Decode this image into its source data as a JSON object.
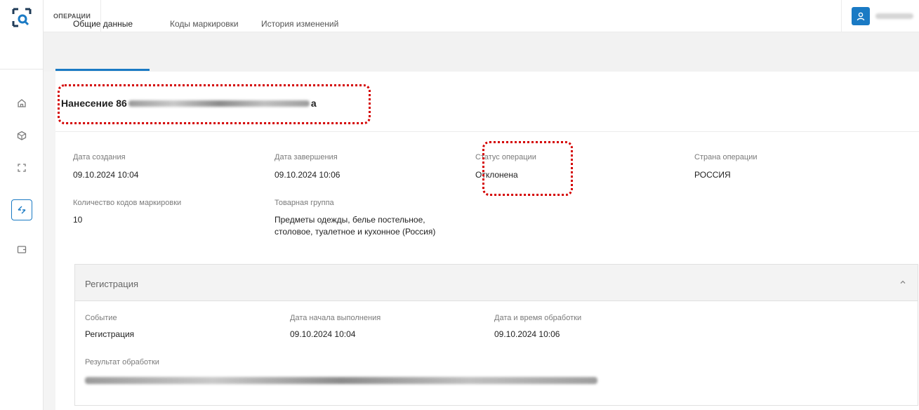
{
  "app": {
    "section_title": "ОПЕРАЦИИ"
  },
  "sidebar": {
    "items": [
      {
        "icon": "home-icon"
      },
      {
        "icon": "package-icon"
      },
      {
        "icon": "scan-icon"
      },
      {
        "icon": "transfer-icon",
        "active": true
      },
      {
        "icon": "wallet-icon"
      }
    ]
  },
  "tabs": [
    {
      "label": "Общие данные",
      "active": true
    },
    {
      "label": "Коды маркировки",
      "active": false
    },
    {
      "label": "История изменений",
      "active": false
    }
  ],
  "operation": {
    "title_prefix": "Нанесение 86",
    "title_suffix": "a"
  },
  "fields": {
    "created_label": "Дата создания",
    "created_value": "09.10.2024 10:04",
    "finished_label": "Дата завершения",
    "finished_value": "09.10.2024 10:06",
    "status_label": "Статус операции",
    "status_value": "Отклонена",
    "country_label": "Страна операции",
    "country_value": "РОССИЯ",
    "codes_count_label": "Количество кодов маркировки",
    "codes_count_value": "10",
    "product_group_label": "Товарная группа",
    "product_group_value_line1": "Предметы одежды, белье постельное,",
    "product_group_value_line2": "столовое, туалетное и кухонное (Россия)"
  },
  "registration": {
    "title": "Регистрация",
    "event_label": "Событие",
    "event_value": "Регистрация",
    "start_label": "Дата начала выполнения",
    "start_value": "09.10.2024 10:04",
    "processed_label": "Дата и время обработки",
    "processed_value": "09.10.2024 10:06",
    "result_label": "Результат обработки"
  },
  "colors": {
    "accent": "#1a7ac4",
    "highlight": "#d40000"
  }
}
